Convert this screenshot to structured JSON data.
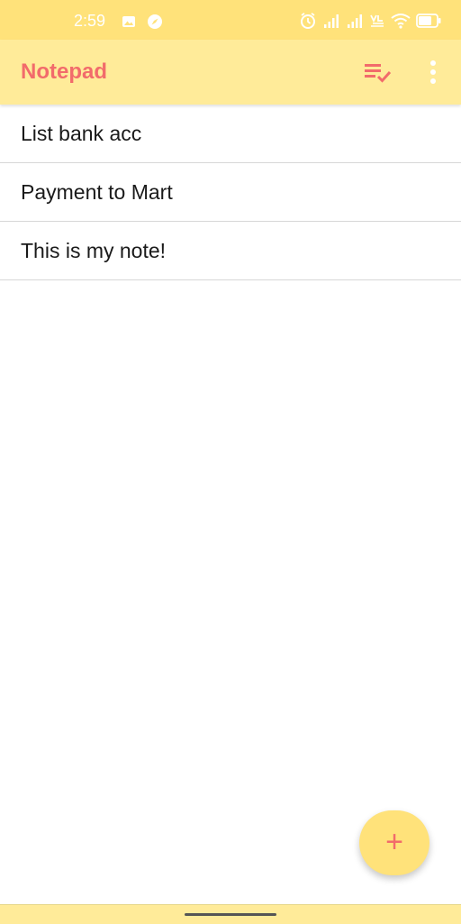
{
  "status_bar": {
    "time": "2:59",
    "left_icons": [
      "image-icon",
      "compass-icon"
    ],
    "right_icons": [
      "alarm-icon",
      "signal-icon",
      "signal-icon",
      "volte-icon",
      "wifi-icon",
      "battery-icon"
    ],
    "battery_level": "64"
  },
  "app_bar": {
    "title": "Notepad",
    "actions": [
      "sort-check-icon",
      "more-vert-icon"
    ]
  },
  "notes": [
    {
      "title": "List bank acc"
    },
    {
      "title": "Payment to Mart"
    },
    {
      "title": "This is my note!"
    }
  ],
  "fab": {
    "icon": "plus-icon",
    "label": "+"
  },
  "colors": {
    "status_bar_bg": "#FFE27A",
    "app_bar_bg": "#FFEB99",
    "accent": "#F26B6B",
    "fab_bg": "#FFE27A"
  }
}
